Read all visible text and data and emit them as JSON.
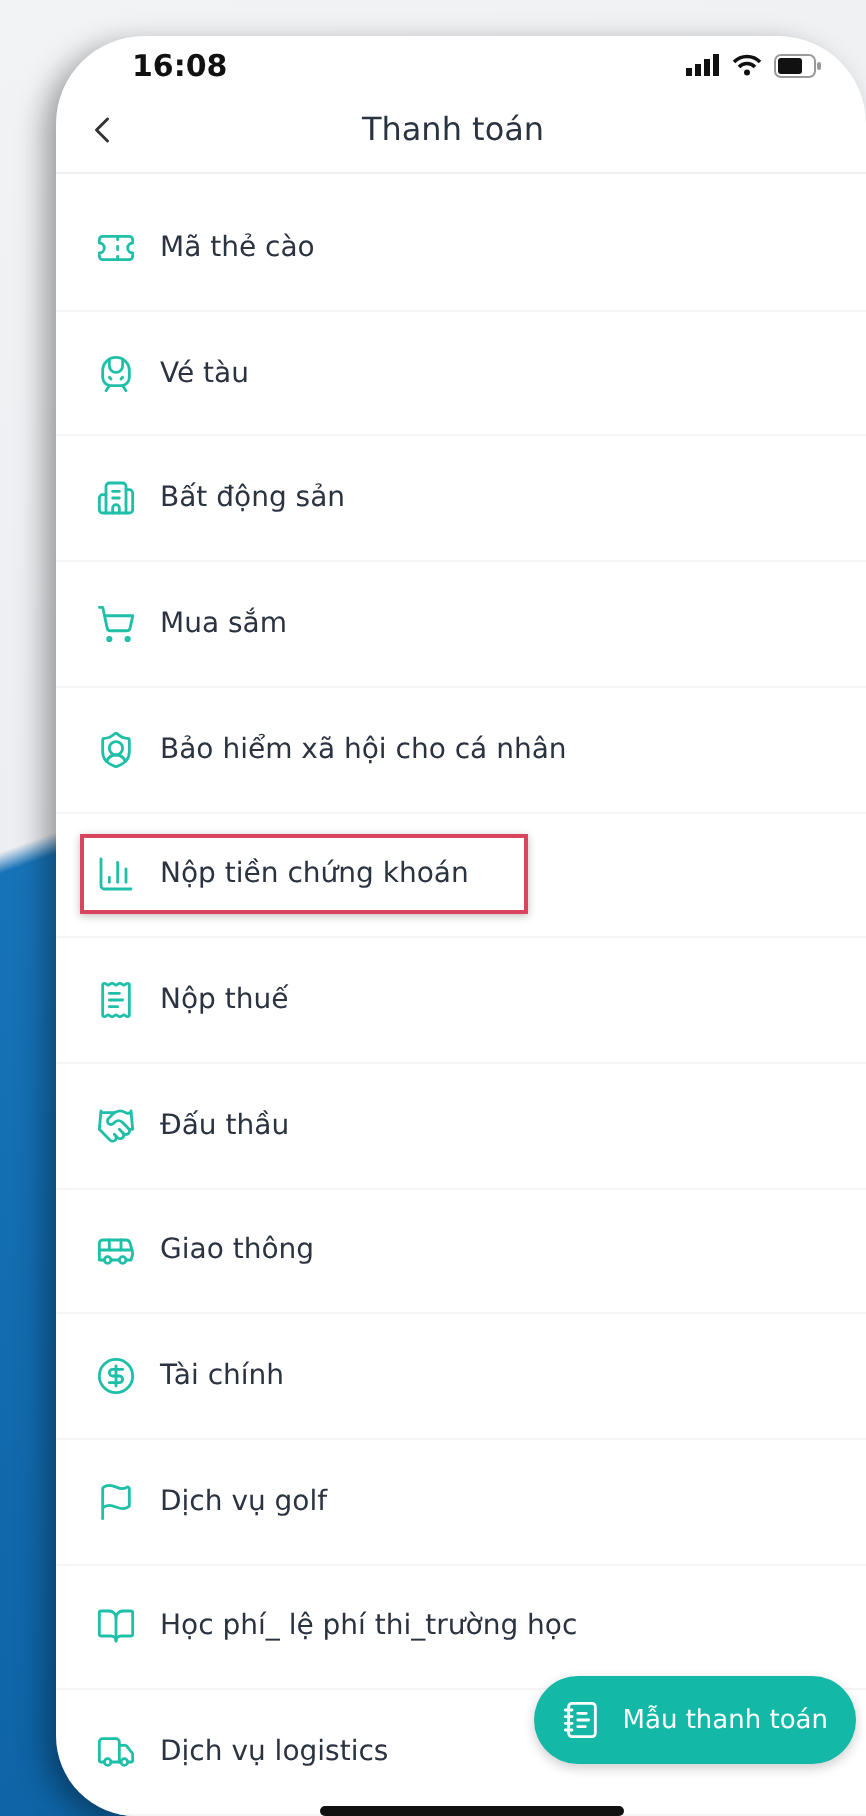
{
  "status_bar": {
    "time": "16:08"
  },
  "header": {
    "title": "Thanh toán"
  },
  "items": [
    {
      "label": "Mã thẻ cào",
      "highlighted": false
    },
    {
      "label": "Vé tàu",
      "highlighted": false
    },
    {
      "label": "Bất động sản",
      "highlighted": false
    },
    {
      "label": "Mua sắm",
      "highlighted": false
    },
    {
      "label": "Bảo hiểm xã hội cho cá nhân",
      "highlighted": false
    },
    {
      "label": "Nộp tiền chứng khoán",
      "highlighted": true
    },
    {
      "label": "Nộp thuế",
      "highlighted": false
    },
    {
      "label": "Đấu thầu",
      "highlighted": false
    },
    {
      "label": "Giao thông",
      "highlighted": false
    },
    {
      "label": "Tài chính",
      "highlighted": false
    },
    {
      "label": "Dịch vụ golf",
      "highlighted": false
    },
    {
      "label": "Học phí_ lệ phí thi_trường học",
      "highlighted": false
    },
    {
      "label": "Dịch vụ logistics",
      "highlighted": false
    }
  ],
  "fab": {
    "label": "Mẫu thanh toán"
  }
}
